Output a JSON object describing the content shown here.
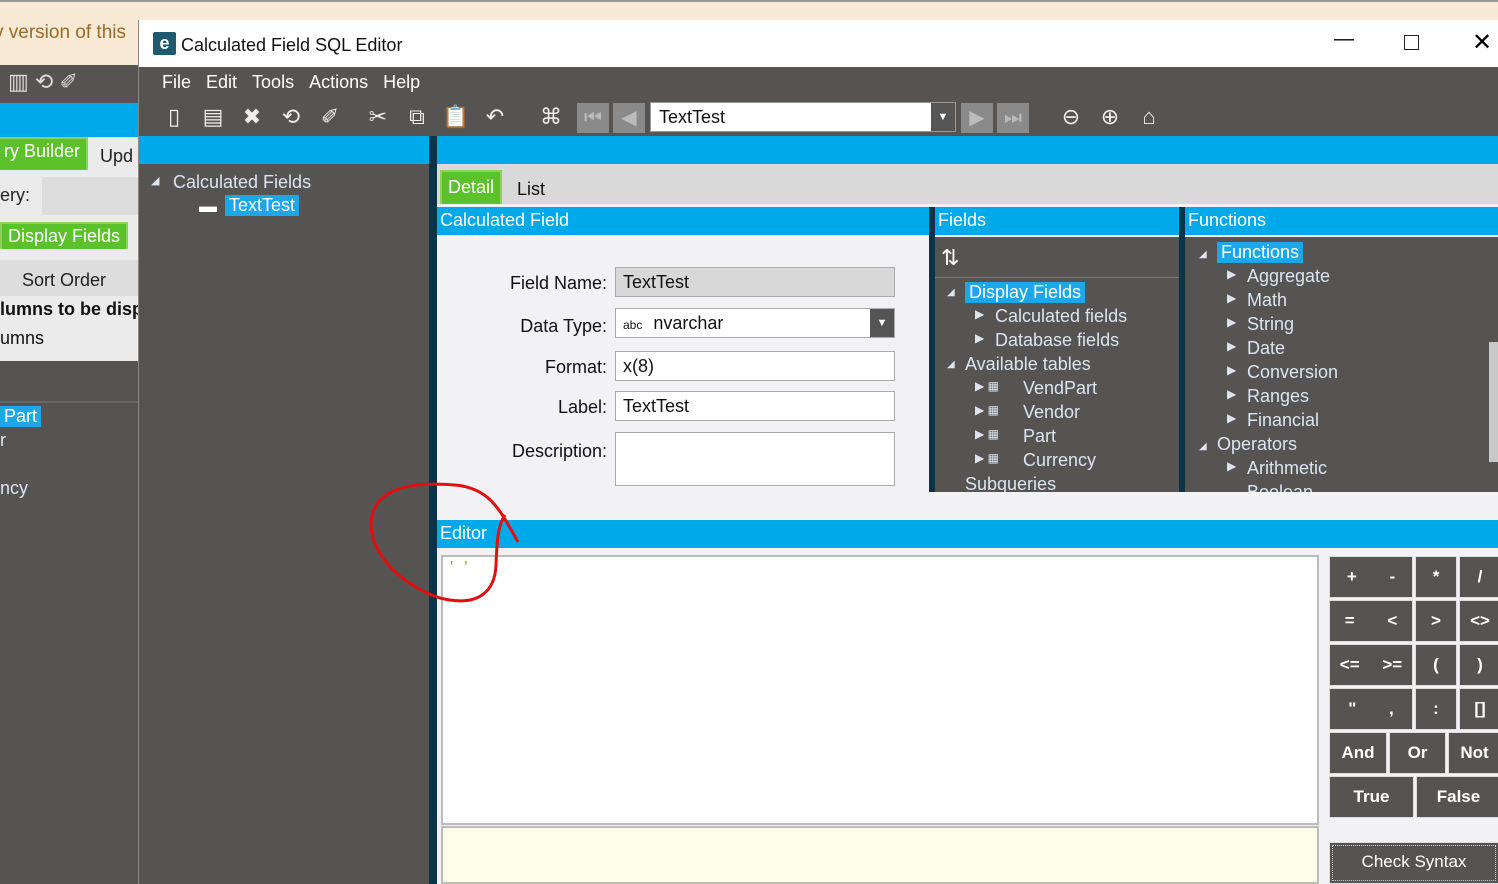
{
  "background_window": {
    "banner_text": "v version of this",
    "tabs": [
      "ry Builder",
      "Upd"
    ],
    "query_label": "ery:",
    "display_fields_tab": "Display Fields",
    "sort_order_tab": "Sort Order",
    "columns_bold": "lumns to be disp",
    "columns_text": "umns",
    "list_items": [
      "Part",
      "r",
      "ncy"
    ]
  },
  "dialog": {
    "title": "Calculated Field SQL Editor",
    "menu": [
      "File",
      "Edit",
      "Tools",
      "Actions",
      "Help"
    ],
    "record_selector": "TextTest",
    "tree": {
      "root": "Calculated Fields",
      "child": "TextTest"
    },
    "tabs": [
      "Detail",
      "List"
    ],
    "active_tab": "Detail",
    "calc_field": {
      "header": "Calculated Field",
      "field_name_label": "Field Name:",
      "field_name": "TextTest",
      "data_type_label": "Data Type:",
      "data_type_prefix": "abc",
      "data_type": "nvarchar",
      "format_label": "Format:",
      "format": "x(8)",
      "label_label": "Label:",
      "label": "TextTest",
      "description_label": "Description:",
      "description": ""
    },
    "fields": {
      "header": "Fields",
      "items": [
        "Display Fields",
        "Calculated fields",
        "Database fields",
        "Available tables",
        "VendPart",
        "Vendor",
        "Part",
        "Currency",
        "Subqueries"
      ]
    },
    "functions": {
      "header": "Functions",
      "items": [
        "Functions",
        "Aggregate",
        "Math",
        "String",
        "Date",
        "Conversion",
        "Ranges",
        "Financial",
        "Operators",
        "Arithmetic",
        "Boolean"
      ]
    },
    "editor": {
      "header": "Editor",
      "content": "' '"
    },
    "operators": {
      "row1": [
        "+",
        "-",
        "*",
        "/"
      ],
      "row2": [
        "=",
        "<",
        ">",
        "<>"
      ],
      "row3": [
        "<=",
        ">=",
        "(",
        ")"
      ],
      "row4": [
        "\"",
        ",",
        ":",
        "[]"
      ],
      "row5": [
        "And",
        "Or",
        "Not"
      ],
      "row6": [
        "True",
        "False"
      ]
    },
    "check_syntax": "Check Syntax",
    "colors": {
      "accent": "#00a9ea",
      "tab_green": "#5cc22c",
      "panel_dark": "#555452"
    }
  }
}
